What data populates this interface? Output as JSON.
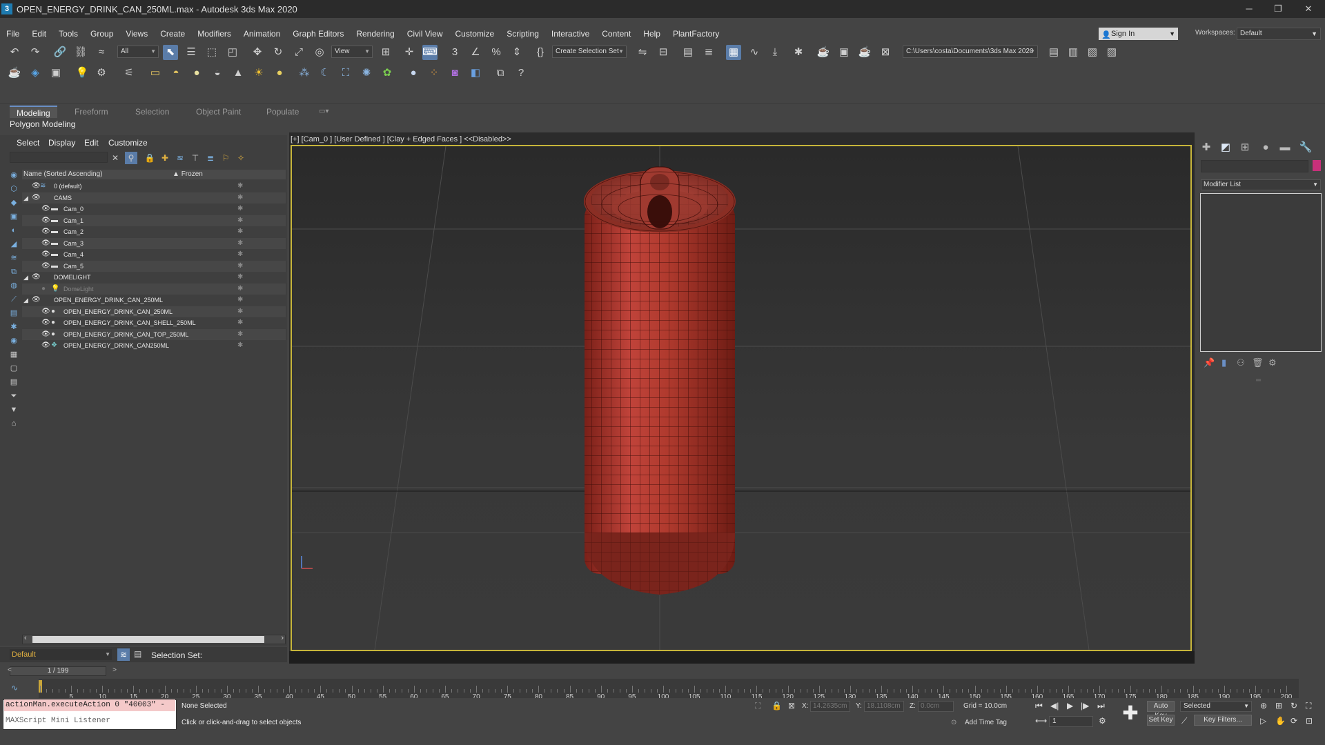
{
  "titlebar": {
    "app_icon": "3",
    "title": "OPEN_ENERGY_DRINK_CAN_250ML.max - Autodesk 3ds Max 2020",
    "min": "─",
    "restore": "❐",
    "close": "✕"
  },
  "menu": [
    "File",
    "Edit",
    "Tools",
    "Group",
    "Views",
    "Create",
    "Modifiers",
    "Animation",
    "Graph Editors",
    "Rendering",
    "Civil View",
    "Customize",
    "Scripting",
    "Interactive",
    "Content",
    "Help",
    "PlantFactory"
  ],
  "signin": {
    "label": "Sign In"
  },
  "workspace": {
    "label": "Workspaces:",
    "value": "Default"
  },
  "toolbar": {
    "filter_value": "All",
    "ref_coord": "View",
    "selection_set": "Create Selection Set",
    "project_path": "C:\\Users\\costa\\Documents\\3ds Max 2020"
  },
  "ribbon": {
    "tabs": [
      "Modeling",
      "Freeform",
      "Selection",
      "Object Paint",
      "Populate"
    ],
    "active": "Modeling",
    "sub": "Polygon Modeling"
  },
  "scene_explorer": {
    "menus": [
      "Select",
      "Display",
      "Edit",
      "Customize"
    ],
    "header": {
      "name": "Name (Sorted Ascending)",
      "frozen": "Frozen"
    },
    "rows": [
      {
        "label": "0 (default)",
        "level": 0
      },
      {
        "label": "CAMS",
        "level": 0
      },
      {
        "label": "Cam_0",
        "level": 1
      },
      {
        "label": "Cam_1",
        "level": 1
      },
      {
        "label": "Cam_2",
        "level": 1
      },
      {
        "label": "Cam_3",
        "level": 1
      },
      {
        "label": "Cam_4",
        "level": 1
      },
      {
        "label": "Cam_5",
        "level": 1
      },
      {
        "label": "DOMELIGHT",
        "level": 0
      },
      {
        "label": "DomeLight",
        "level": 1
      },
      {
        "label": "OPEN_ENERGY_DRINK_CAN_250ML",
        "level": 0
      },
      {
        "label": "OPEN_ENERGY_DRINK_CAN_250ML",
        "level": 1
      },
      {
        "label": "OPEN_ENERGY_DRINK_CAN_SHELL_250ML",
        "level": 1
      },
      {
        "label": "OPEN_ENERGY_DRINK_CAN_TOP_250ML",
        "level": 1
      },
      {
        "label": "OPEN_ENERGY_DRINK_CAN250ML",
        "level": 1
      }
    ],
    "layer": "Default",
    "selection_set_label": "Selection Set:"
  },
  "viewport": {
    "label": "[+] [Cam_0 ] [User Defined ] [Clay + Edged Faces ]  <<Disabled>>",
    "mesh_color": "#b0392c",
    "border_color": "#c7b53a"
  },
  "command_panel": {
    "modifier_list": "Modifier List",
    "object_color": "#c8307a"
  },
  "timeline": {
    "frame_display": "1 / 199",
    "ticks": [
      "5",
      "10",
      "15",
      "20",
      "25",
      "30",
      "35",
      "40",
      "45",
      "50",
      "55",
      "60",
      "65",
      "70",
      "75",
      "80",
      "85",
      "90",
      "95",
      "100",
      "105",
      "110",
      "115",
      "120",
      "125",
      "130",
      "135",
      "140",
      "145",
      "150",
      "155",
      "160",
      "165",
      "170",
      "175",
      "180",
      "185",
      "190",
      "195",
      "200"
    ]
  },
  "status": {
    "maxscript_line": "actionMan.executeAction 0 \"40003\"  -",
    "maxscript_listener": "MAXScript Mini Listener",
    "selection": "None Selected",
    "prompt": "Click or click-and-drag to select objects",
    "x_label": "X:",
    "x_value": "14.2635cm",
    "y_label": "Y:",
    "y_value": "18.1108cm",
    "z_label": "Z:",
    "z_value": "0.0cm",
    "grid": "Grid = 10.0cm",
    "add_time_tag": "Add Time Tag",
    "current_frame": "1",
    "auto_key": "Auto Key",
    "set_key": "Set Key",
    "key_mode": "Selected",
    "key_filters": "Key Filters..."
  }
}
